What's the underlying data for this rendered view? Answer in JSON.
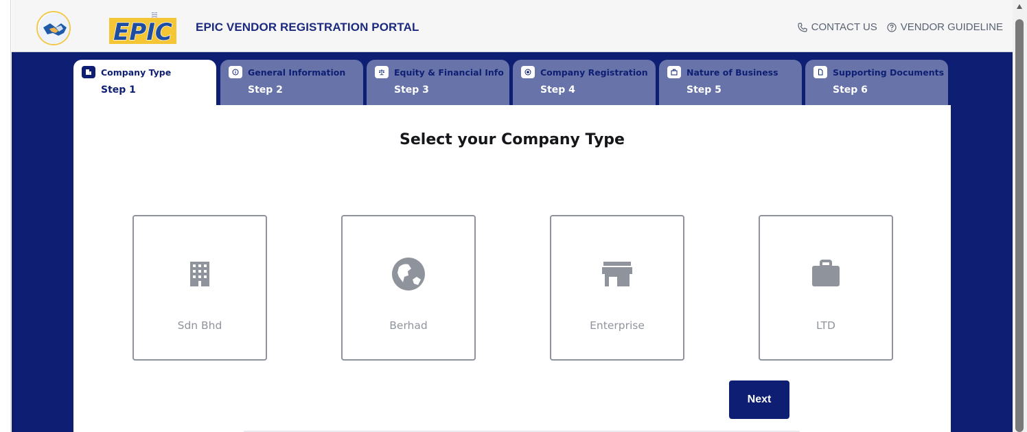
{
  "header": {
    "title": "EPIC VENDOR REGISTRATION PORTAL",
    "logo_text": "EPIC",
    "contact_label": "CONTACT US",
    "guideline_label": "VENDOR GUIDELINE"
  },
  "tabs": [
    {
      "label": "Company Type",
      "step": "Step 1",
      "active": true,
      "icon": "building-icon"
    },
    {
      "label": "General Information",
      "step": "Step 2",
      "active": false,
      "icon": "info-icon"
    },
    {
      "label": "Equity & Financial Info",
      "step": "Step 3",
      "active": false,
      "icon": "scale-icon"
    },
    {
      "label": "Company Registration",
      "step": "Step 4",
      "active": false,
      "icon": "record-icon"
    },
    {
      "label": "Nature of Business",
      "step": "Step 5",
      "active": false,
      "icon": "briefcase-icon"
    },
    {
      "label": "Supporting Documents",
      "step": "Step 6",
      "active": false,
      "icon": "document-icon"
    }
  ],
  "main": {
    "title": "Select your Company Type",
    "options": [
      {
        "label": "Sdn Bhd",
        "icon": "building-icon"
      },
      {
        "label": "Berhad",
        "icon": "globe-icon"
      },
      {
        "label": "Enterprise",
        "icon": "store-icon"
      },
      {
        "label": "LTD",
        "icon": "briefcase-icon"
      }
    ],
    "next_label": "Next"
  },
  "colors": {
    "primary": "#0e1f73",
    "tab_inactive": "#6874a9",
    "card_border": "#8d929c",
    "icon_gray": "#8f949c"
  }
}
